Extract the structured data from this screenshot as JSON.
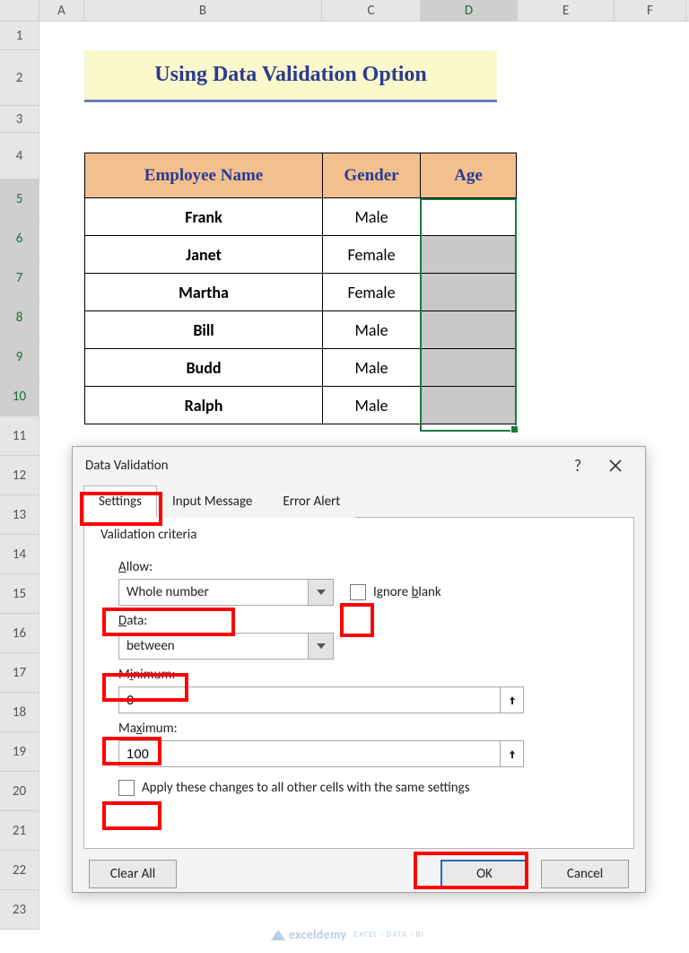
{
  "columns": [
    "A",
    "B",
    "C",
    "D",
    "E",
    "F"
  ],
  "rows": [
    "1",
    "2",
    "3",
    "4",
    "5",
    "6",
    "7",
    "8",
    "9",
    "10",
    "11",
    "12",
    "13",
    "14",
    "15",
    "16",
    "17",
    "18",
    "19",
    "20",
    "21",
    "22",
    "23"
  ],
  "active_column": "D",
  "selected_rows": [
    "5",
    "6",
    "7",
    "8",
    "9",
    "10"
  ],
  "title": "Using Data Validation Option",
  "table": {
    "headers": {
      "name": "Employee Name",
      "gender": "Gender",
      "age": "Age"
    },
    "rows": [
      {
        "name": "Frank",
        "gender": "Male"
      },
      {
        "name": "Janet",
        "gender": "Female"
      },
      {
        "name": "Martha",
        "gender": "Female"
      },
      {
        "name": "Bill",
        "gender": "Male"
      },
      {
        "name": "Budd",
        "gender": "Male"
      },
      {
        "name": "Ralph",
        "gender": "Male"
      }
    ]
  },
  "dialog": {
    "title": "Data Validation",
    "tabs": {
      "settings": "Settings",
      "input_message": "Input Message",
      "error_alert": "Error Alert"
    },
    "criteria_label": "Validation criteria",
    "allow_label": "Allow:",
    "allow_value": "Whole number",
    "ignore_blank_label": "Ignore blank",
    "ignore_blank_checked": false,
    "data_label": "Data:",
    "data_value": "between",
    "minimum_label": "Minimum:",
    "minimum_value": "0",
    "maximum_label": "Maximum:",
    "maximum_value": "100",
    "apply_all_label": "Apply these changes to all other cells with the same settings",
    "apply_all_checked": false,
    "clear_all": "Clear All",
    "ok": "OK",
    "cancel": "Cancel"
  },
  "watermark": {
    "brand": "exceldemy",
    "tag": "EXCEL · DATA · BI"
  }
}
